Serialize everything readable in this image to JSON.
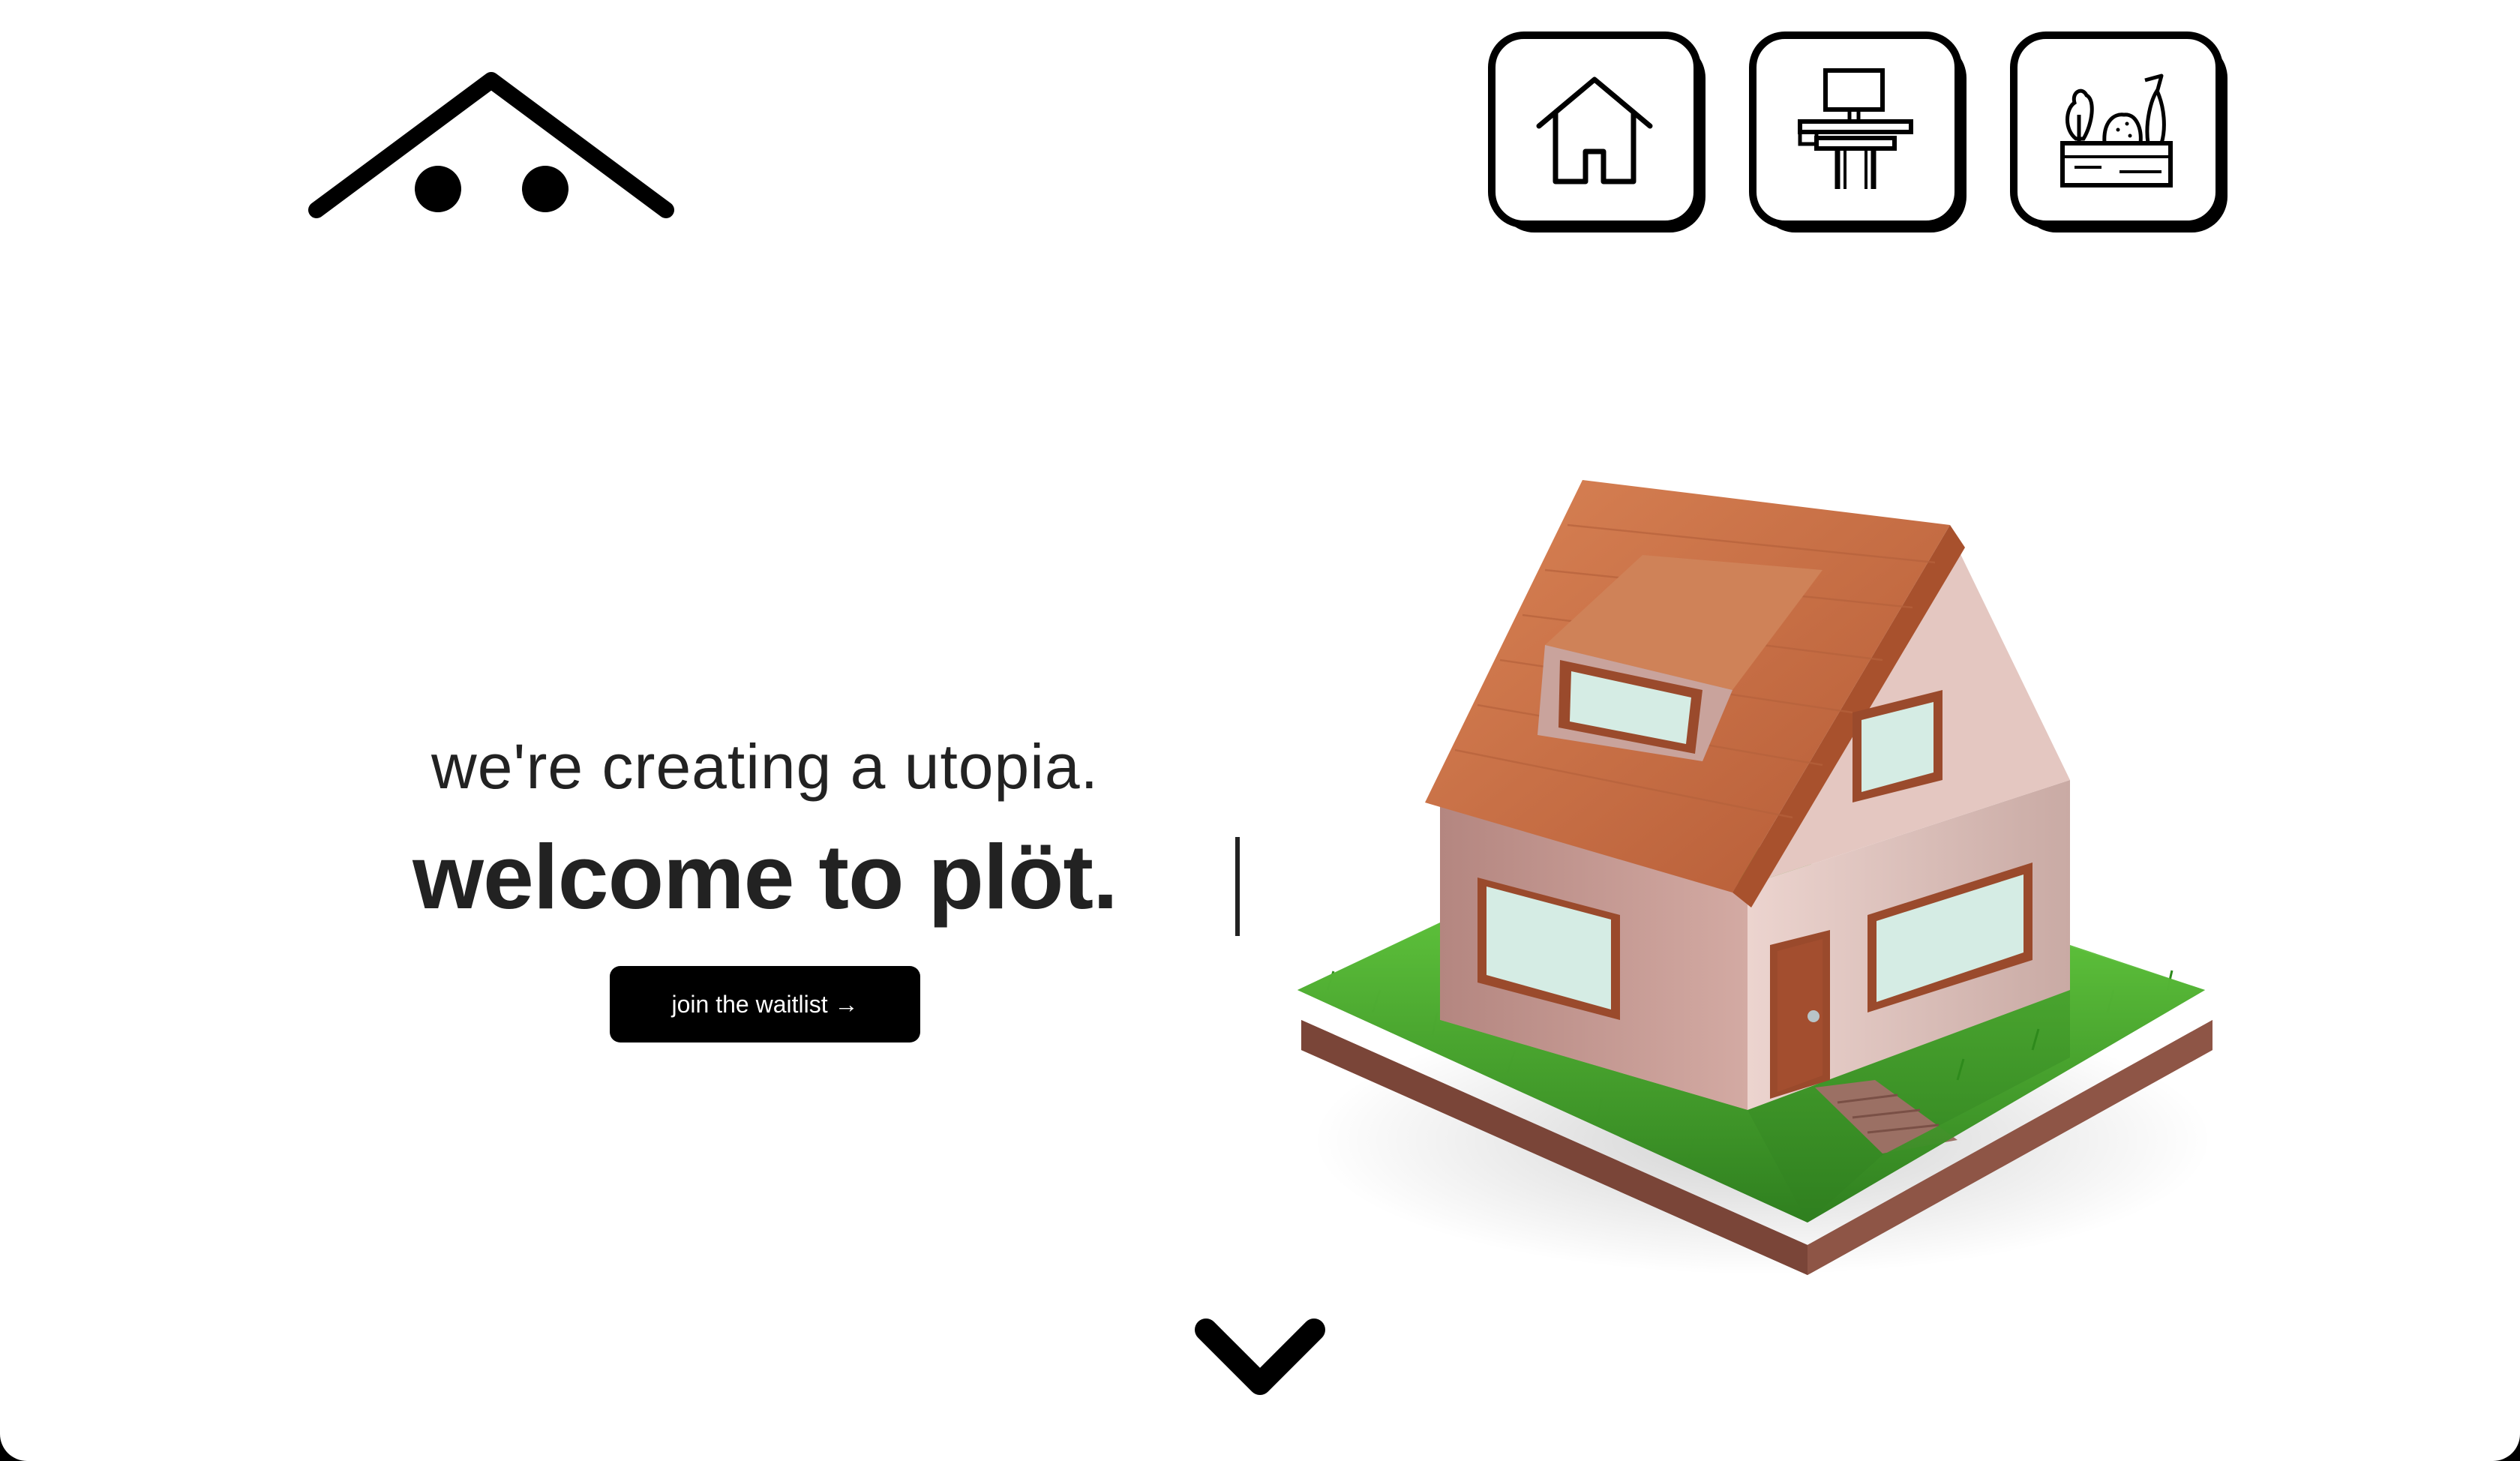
{
  "logo": {
    "name": "plöt-roof-logo",
    "icon": "roof-eyes-icon"
  },
  "nav": {
    "items": [
      {
        "icon": "house-icon"
      },
      {
        "icon": "desk-icon"
      },
      {
        "icon": "garden-box-icon"
      }
    ]
  },
  "hero": {
    "tagline": "we're creating a utopia.",
    "headline": "welcome to plöt.",
    "cta_label": "join the waitlist →"
  },
  "scroll": {
    "icon": "chevron-down-icon"
  },
  "colors": {
    "text": "#222222",
    "button_bg": "#000000",
    "button_text": "#ffffff",
    "roof": "#c46a3f",
    "wall": "#d9b8b2",
    "grass": "#3f9b2a",
    "soil": "#8a4f3f"
  }
}
